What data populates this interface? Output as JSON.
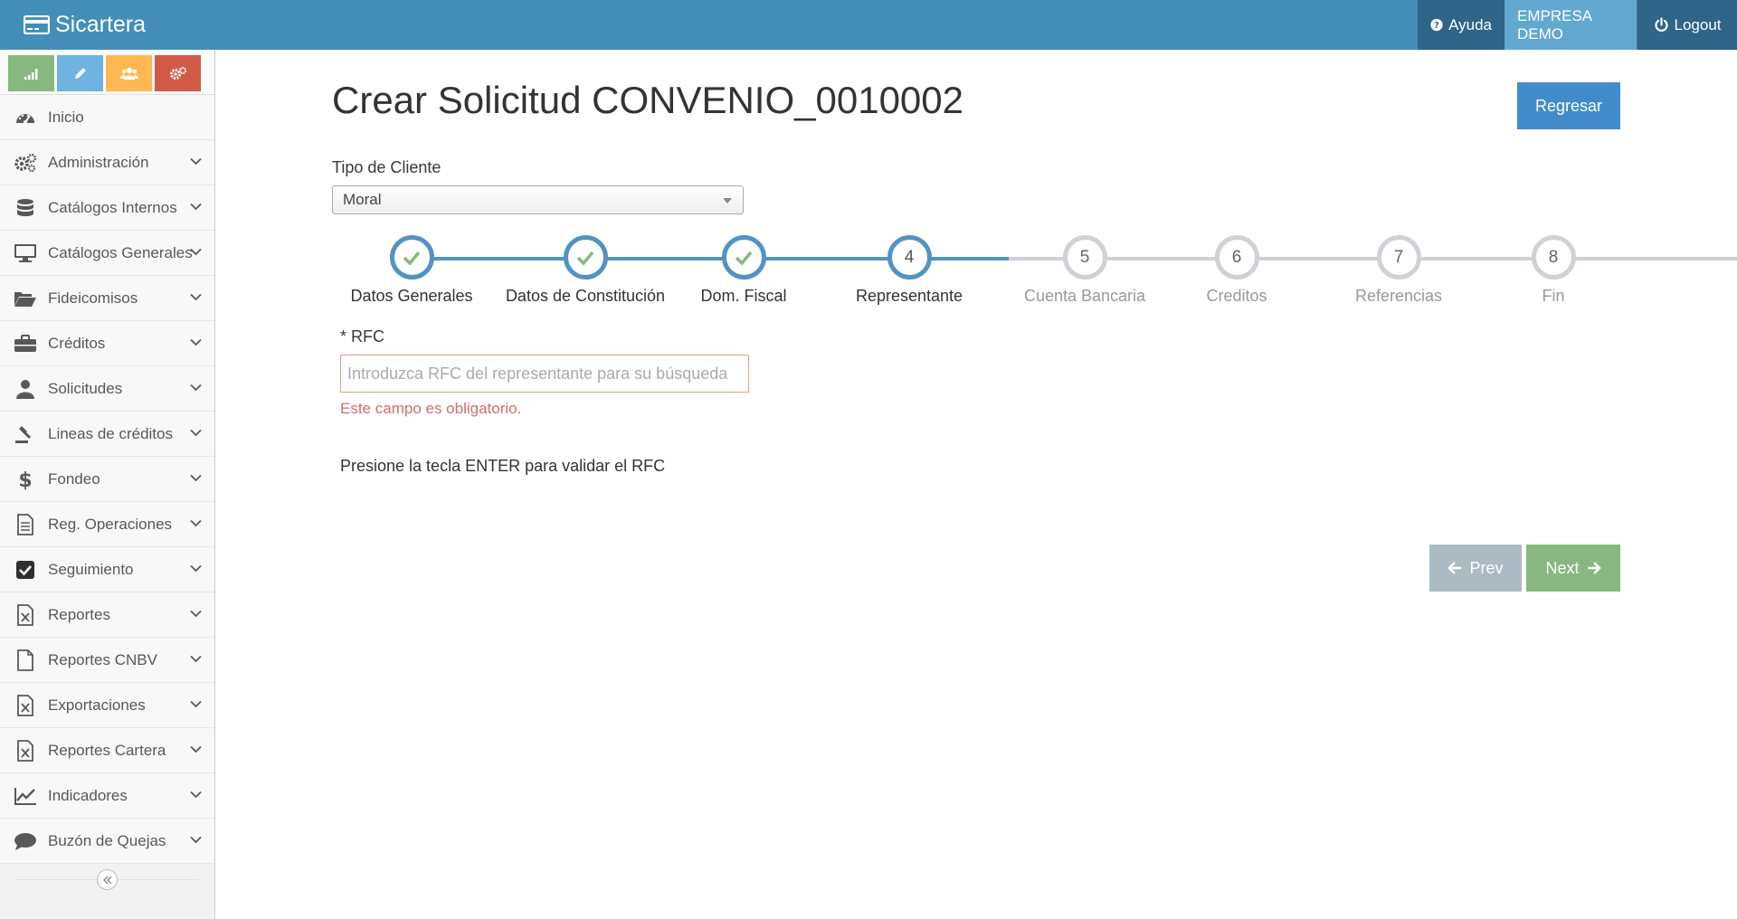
{
  "app": {
    "brand": "Sicartera"
  },
  "navbar": {
    "help": "Ayuda",
    "company": "EMPRESA DEMO",
    "logout": "Logout"
  },
  "sidebar": {
    "items": [
      {
        "label": "Inicio",
        "icon": "dashboard-icon"
      },
      {
        "label": "Administración",
        "icon": "cogs-icon"
      },
      {
        "label": "Catálogos Internos",
        "icon": "database-icon"
      },
      {
        "label": "Catálogos Generales",
        "icon": "desktop-icon"
      },
      {
        "label": "Fideicomisos",
        "icon": "folder-open-icon"
      },
      {
        "label": "Créditos",
        "icon": "briefcase-icon"
      },
      {
        "label": "Solicitudes",
        "icon": "user-icon"
      },
      {
        "label": "Lineas de créditos",
        "icon": "gavel-icon"
      },
      {
        "label": "Fondeo",
        "icon": "dollar-icon"
      },
      {
        "label": "Reg. Operaciones",
        "icon": "file-text-icon"
      },
      {
        "label": "Seguimiento",
        "icon": "check-square-icon"
      },
      {
        "label": "Reportes",
        "icon": "file-excel-icon"
      },
      {
        "label": "Reportes CNBV",
        "icon": "file-icon"
      },
      {
        "label": "Exportaciones",
        "icon": "file-excel-icon"
      },
      {
        "label": "Reportes Cartera",
        "icon": "file-excel-icon"
      },
      {
        "label": "Indicadores",
        "icon": "line-chart-icon"
      },
      {
        "label": "Buzón de Quejas",
        "icon": "comment-icon"
      }
    ]
  },
  "page": {
    "title": "Crear Solicitud CONVENIO_0010002",
    "back_button": "Regresar",
    "client_type_label": "Tipo de Cliente",
    "client_type_value": "Moral"
  },
  "wizard": {
    "steps": [
      {
        "number": "1",
        "title": "Datos Generales",
        "state": "complete"
      },
      {
        "number": "2",
        "title": "Datos de Constitución",
        "state": "complete"
      },
      {
        "number": "3",
        "title": "Dom. Fiscal",
        "state": "complete"
      },
      {
        "number": "4",
        "title": "Representante",
        "state": "active"
      },
      {
        "number": "5",
        "title": "Cuenta Bancaria",
        "state": "pending"
      },
      {
        "number": "6",
        "title": "Creditos",
        "state": "pending"
      },
      {
        "number": "7",
        "title": "Referencias",
        "state": "pending"
      },
      {
        "number": "8",
        "title": "Fin",
        "state": "pending"
      }
    ]
  },
  "form": {
    "rfc_label": "* RFC",
    "rfc_placeholder": "Introduzca RFC del representante para su búsqueda",
    "rfc_value": "",
    "rfc_error": "Este campo es obligatorio.",
    "rfc_hint": "Presione la tecla ENTER para validar el RFC"
  },
  "buttons": {
    "prev": "Prev",
    "next": "Next"
  },
  "colors": {
    "navbar": "#438eb9",
    "primary": "#428bca",
    "success": "#87b87f",
    "step_active": "#5293c4",
    "step_pending": "#ced1d6",
    "error": "#d16e6c",
    "check": "#87b87f"
  }
}
